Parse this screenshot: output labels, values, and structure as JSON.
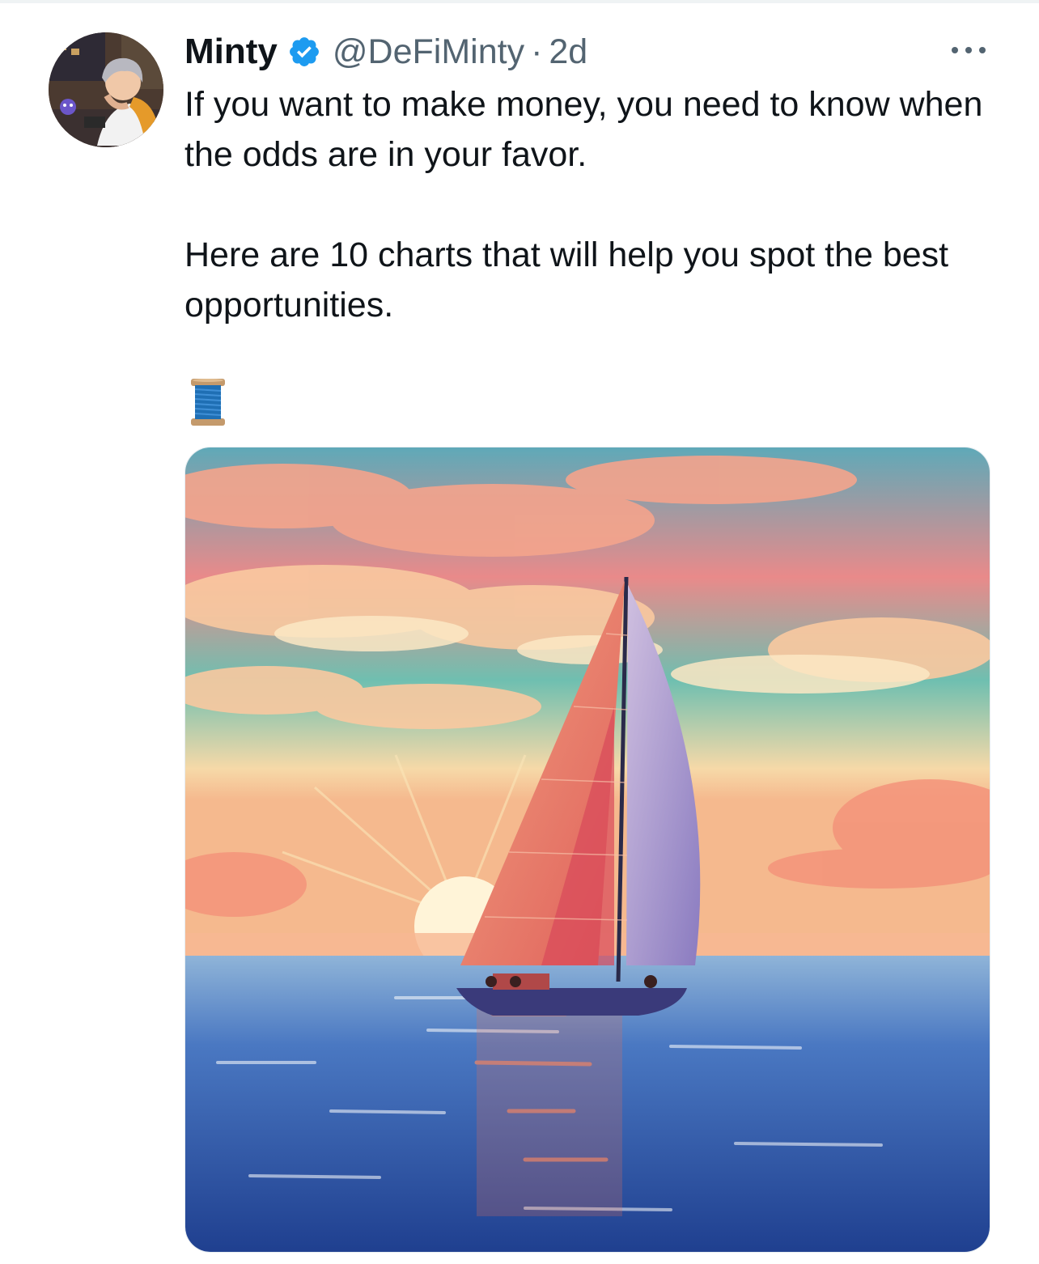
{
  "tweet": {
    "author": {
      "display_name": "Minty",
      "handle": "@DeFiMinty",
      "verified": true
    },
    "separator": "·",
    "time": "2d",
    "text_paragraph_1": "If you want to make money, you need to know when the odds are in your favor.",
    "text_paragraph_2": "Here are 10 charts that will help you spot the best opportunities.",
    "thread_emoji": "spool-of-thread-icon"
  },
  "colors": {
    "verified_blue": "#1d9bf0",
    "secondary_text": "#536471",
    "primary_text": "#0f1419"
  }
}
